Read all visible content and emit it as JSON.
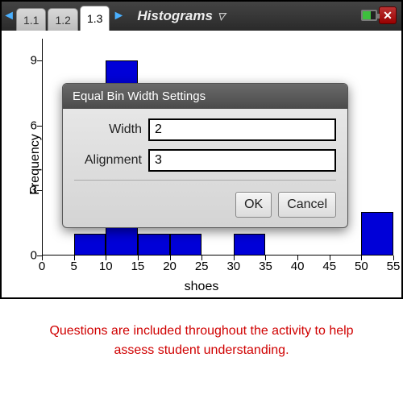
{
  "titlebar": {
    "tabs": [
      "1.1",
      "1.2",
      "1.3"
    ],
    "active_tab_index": 2,
    "doc_title": "Histograms"
  },
  "dialog": {
    "title": "Equal Bin Width Settings",
    "width_label": "Width",
    "width_value": "2",
    "alignment_label": "Alignment",
    "alignment_value": "3",
    "ok": "OK",
    "cancel": "Cancel"
  },
  "footer": "Questions are included throughout the activity to help assess student understanding.",
  "chart_data": {
    "type": "bar",
    "xlabel": "shoes",
    "ylabel": "Frequency",
    "x_ticks": [
      0,
      5,
      10,
      15,
      20,
      25,
      30,
      35,
      40,
      45,
      50,
      55
    ],
    "y_ticks": [
      0,
      3,
      6,
      9
    ],
    "xlim": [
      0,
      55
    ],
    "ylim": [
      0,
      10
    ],
    "bin_width": 5,
    "bars": [
      {
        "x_start": 5,
        "x_end": 10,
        "height": 1
      },
      {
        "x_start": 10,
        "x_end": 15,
        "height": 9
      },
      {
        "x_start": 15,
        "x_end": 20,
        "height": 1
      },
      {
        "x_start": 20,
        "x_end": 25,
        "height": 1
      },
      {
        "x_start": 30,
        "x_end": 35,
        "height": 1
      },
      {
        "x_start": 50,
        "x_end": 55,
        "height": 2
      }
    ]
  }
}
